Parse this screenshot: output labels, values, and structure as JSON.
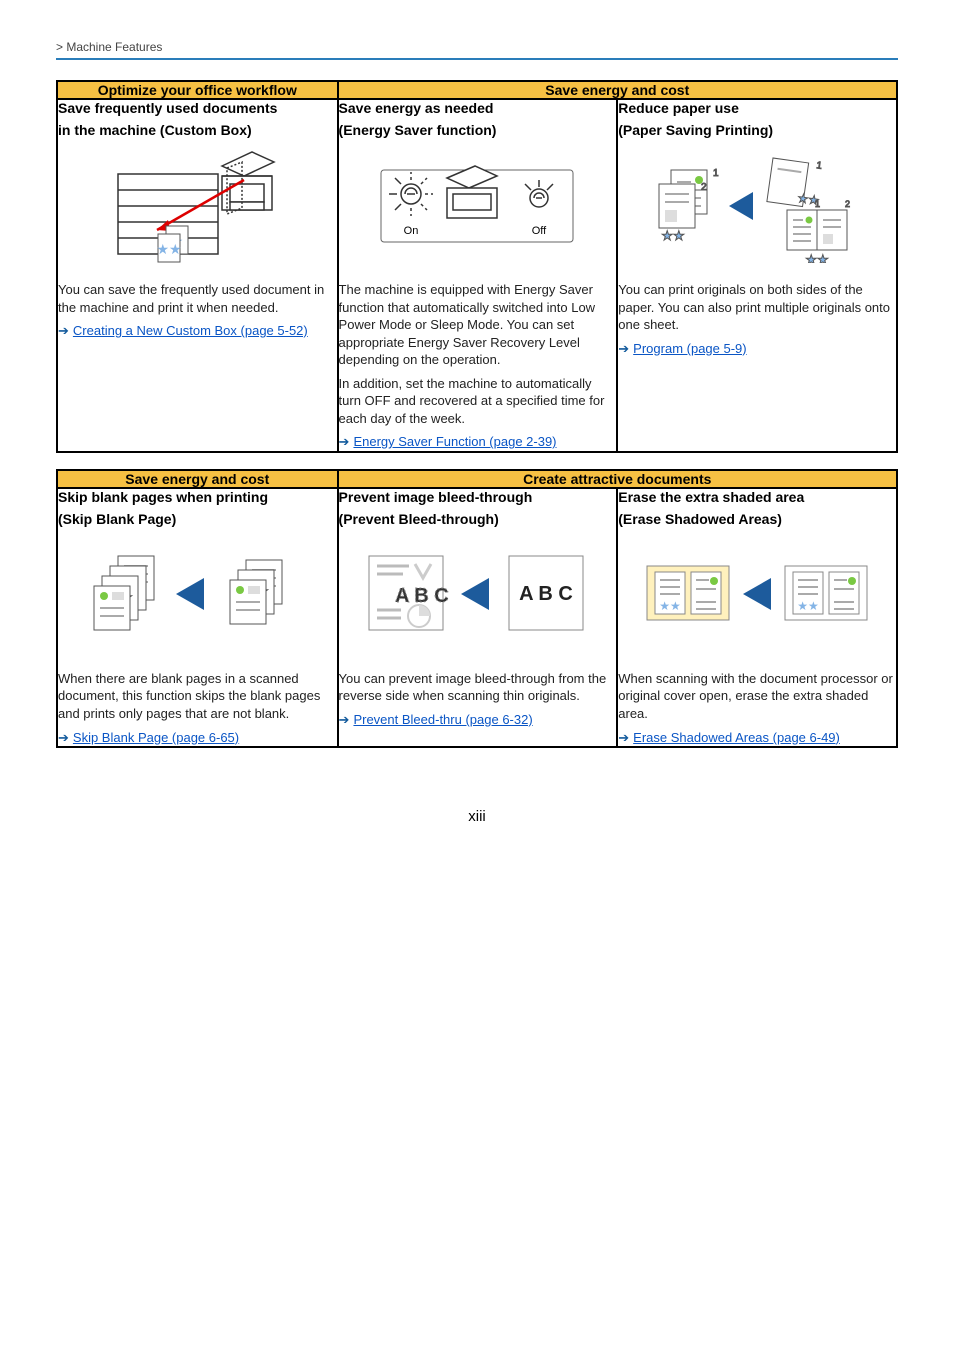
{
  "header": "> Machine Features",
  "tables": [
    {
      "head1": "Optimize your office workflow",
      "head2": "Save energy and cost",
      "c1_title1": "Save frequently used documents",
      "c1_title2": "in the machine (Custom Box)",
      "c1_body": "You can save the frequently used document in the machine and print it when needed.",
      "c1_link": "Creating a New Custom Box (page 5-52)",
      "c2_title1": "Save energy as needed",
      "c2_title2": "(Energy Saver function)",
      "c2_on": "On",
      "c2_off": "Off",
      "c2_body1": "The machine is equipped with Energy Saver function that automatically switched into Low Power Mode or Sleep Mode. You can set appropriate Energy Saver Recovery Level depending on the operation.",
      "c2_body2": "In addition, set the machine to automatically turn OFF and recovered at a specified time for each day of the week.",
      "c2_link": "Energy Saver Function (page 2-39)",
      "c3_title1": "Reduce paper use",
      "c3_title2": "(Paper Saving Printing)",
      "c3_body": "You can print originals on both sides of the paper. You can also print multiple originals onto one sheet.",
      "c3_link": "Program (page 5-9)"
    },
    {
      "head1": "Save energy and cost",
      "head2": "Create attractive documents",
      "c1_title1": "Skip blank pages when printing",
      "c1_title2": "(Skip Blank Page)",
      "c1_body": "When there are blank pages in a scanned document, this function skips the blank pages and prints only pages that are not blank.",
      "c1_link": "Skip Blank Page (page 6-65)",
      "c2_title1": "Prevent image bleed-through",
      "c2_title2": "(Prevent Bleed-through)",
      "c2_abc_ghost": "A B C",
      "c2_abc_solid": "A B C",
      "c2_body": "You can prevent image bleed-through from the reverse side when scanning thin originals.",
      "c2_link": "Prevent Bleed-thru (page 6-32)",
      "c3_title1": "Erase the extra shaded area",
      "c3_title2": "(Erase Shadowed Areas)",
      "c3_body": "When scanning with the document processor or original cover open, erase the extra shaded area.",
      "c3_link": "Erase Shadowed Areas (page 6-49)"
    }
  ],
  "page_num": "xiii"
}
